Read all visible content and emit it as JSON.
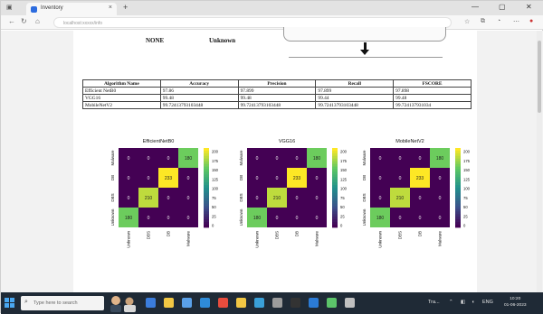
{
  "browser": {
    "tab_title": "Inventory",
    "new_tab": "+",
    "close_tab": "×",
    "address": "localhost:xxxxx/info",
    "window_controls": [
      "—",
      "▢",
      "✕"
    ]
  },
  "top_fragment": {
    "none_label": "NONE",
    "unknown_label": "Unknown"
  },
  "results_table": {
    "headers": [
      "Algorithm Name",
      "Accuracy",
      "Precision",
      "Recall",
      "FSCORE"
    ],
    "rows": [
      [
        "Efficient NetB0",
        "97.86",
        "97.899",
        "97.899",
        "97.898"
      ],
      [
        "VGG16",
        "99.48",
        "99.48",
        "99.44",
        "99.48"
      ],
      [
        "MobileNetV2",
        "99.72413793103448",
        "99.72413793103448",
        "99.72413793103448",
        "99.724137931034"
      ]
    ]
  },
  "chart_data": [
    {
      "type": "heatmap",
      "title": "EfficientNetB0",
      "row_labels": [
        "Malware",
        "DB",
        "DBS",
        "Unknown"
      ],
      "col_labels": [
        "Unknown",
        "DBS",
        "DB",
        "Malware"
      ],
      "values": [
        [
          0,
          0,
          0,
          180
        ],
        [
          0,
          0,
          233,
          0
        ],
        [
          0,
          210,
          0,
          0
        ],
        [
          180,
          0,
          0,
          0
        ]
      ],
      "colorbar_ticks": [
        "200",
        "175",
        "150",
        "125",
        "100",
        "75",
        "50",
        "25",
        "0"
      ],
      "colormap": "viridis"
    },
    {
      "type": "heatmap",
      "title": "VGG16",
      "row_labels": [
        "Malware",
        "DB",
        "DBS",
        "Unknown"
      ],
      "col_labels": [
        "Unknown",
        "DBS",
        "DB",
        "Malware"
      ],
      "values": [
        [
          0,
          0,
          0,
          180
        ],
        [
          0,
          0,
          233,
          0
        ],
        [
          0,
          210,
          0,
          0
        ],
        [
          180,
          0,
          0,
          0
        ]
      ],
      "colorbar_ticks": [
        "200",
        "175",
        "150",
        "125",
        "100",
        "75",
        "50",
        "25",
        "0"
      ],
      "colormap": "viridis"
    },
    {
      "type": "heatmap",
      "title": "MobileNetV2",
      "row_labels": [
        "Malware",
        "DB",
        "DBS",
        "Unknown"
      ],
      "col_labels": [
        "Unknown",
        "DBS",
        "DB",
        "Malware"
      ],
      "values": [
        [
          0,
          0,
          0,
          180
        ],
        [
          0,
          0,
          233,
          0
        ],
        [
          0,
          210,
          0,
          0
        ],
        [
          180,
          0,
          0,
          0
        ]
      ],
      "colorbar_ticks": [
        "200",
        "175",
        "150",
        "125",
        "100",
        "75",
        "50",
        "25",
        "0"
      ],
      "colormap": "viridis"
    }
  ],
  "taskbar": {
    "search_placeholder": "Type here to search",
    "apps": [
      "edge",
      "explorer",
      "store",
      "mail",
      "chrome",
      "files",
      "photos",
      "settings",
      "terminal",
      "code",
      "misc1",
      "misc2"
    ],
    "tray_text": "Tra...",
    "clock_time": "10:20",
    "clock_date": "01-06-2023",
    "colors": {
      "taskbar": "#1f2a36",
      "accent": "#4aa7f0"
    }
  }
}
